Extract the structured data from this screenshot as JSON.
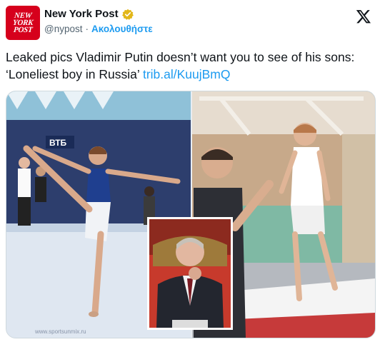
{
  "account": {
    "avatar_lines": [
      "NEW",
      "YORK",
      "POST"
    ],
    "display_name": "New York Post",
    "handle": "@nypost",
    "separator": "·",
    "follow_label": "Ακολουθήστε"
  },
  "tweet": {
    "text": "Leaked pics Vladimir Putin doesn’t want you to see of his sons: ‘Loneliest boy in Russia’ ",
    "link": "trib.al/KuujBmQ"
  },
  "media": {
    "banner_text": "ВТБ",
    "watermark": "www.sportsunmix.ru",
    "description_icons": [
      "gymnast-photo",
      "trainer-photo",
      "putin-inset-photo"
    ]
  },
  "colors": {
    "brand_red": "#d6001c",
    "link_blue": "#1d9bf0",
    "verified_gold": "#e2b719",
    "muted_text": "#536471"
  }
}
